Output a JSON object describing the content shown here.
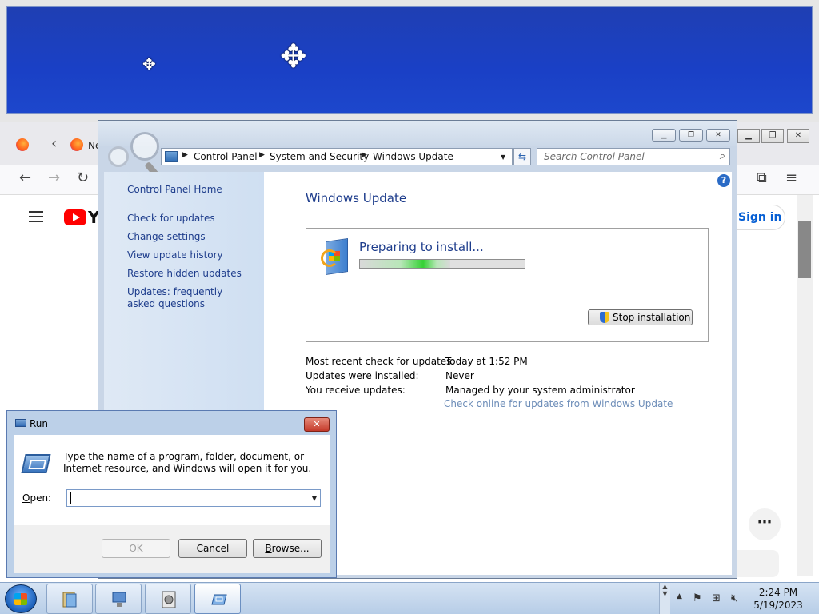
{
  "control_panel": {
    "breadcrumbs": [
      "Control Panel",
      "System and Security",
      "Windows Update"
    ],
    "search_placeholder": "Search Control Panel",
    "sidebar": {
      "home": "Control Panel Home",
      "links": [
        "Check for updates",
        "Change settings",
        "View update history",
        "Restore hidden updates",
        "Updates: frequently asked questions"
      ]
    },
    "main": {
      "title": "Windows Update",
      "status": "Preparing to install...",
      "progress": 0.55,
      "stop_button": "Stop installation",
      "info": [
        {
          "label": "Most recent check for updates:",
          "value": "Today at 1:52 PM"
        },
        {
          "label": "Updates were installed:",
          "value": "Never"
        },
        {
          "label": "You receive updates:",
          "value": "Managed by your system administrator"
        }
      ],
      "check_online": "Check online for updates from Windows Update"
    }
  },
  "run_dialog": {
    "title": "Run",
    "description": "Type the name of a program, folder, document, or Internet resource, and Windows will open it for you.",
    "open_label_prefix": "",
    "open_label_key": "O",
    "open_label_rest": "pen:",
    "input_value": "",
    "ok": "OK",
    "cancel": "Cancel",
    "browse_key": "B",
    "browse_rest": "rowse..."
  },
  "browser": {
    "tab_text": "Ne",
    "yt_text": "Y",
    "sign_in": "Sign in"
  },
  "taskbar": {
    "time": "2:24 PM",
    "date": "5/19/2023"
  }
}
